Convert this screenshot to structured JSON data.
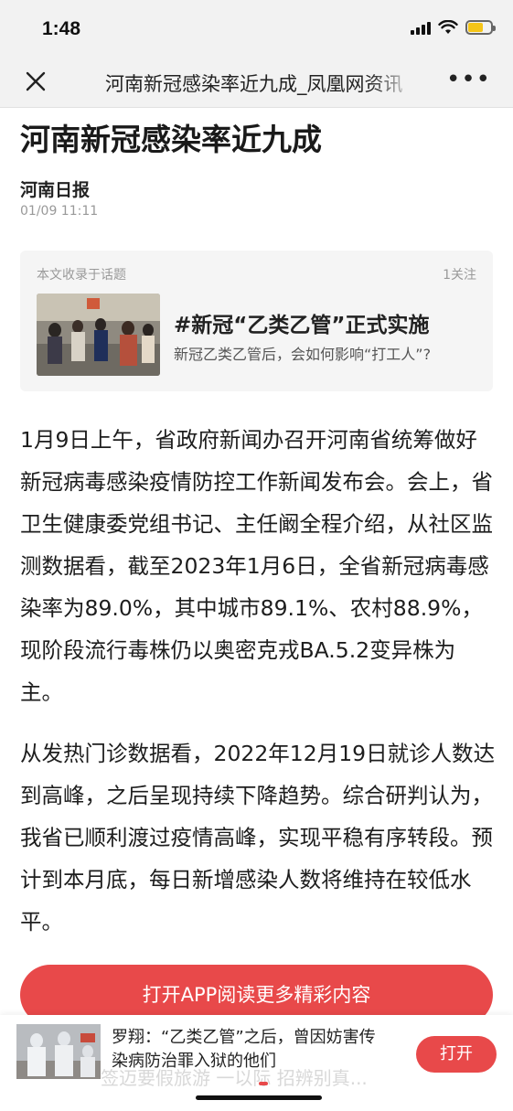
{
  "status_bar": {
    "time": "1:48"
  },
  "nav": {
    "title": "河南新冠感染率近九成_凤凰网资讯",
    "more": "•••"
  },
  "article": {
    "title": "河南新冠感染率近九成",
    "source": "河南日报",
    "date": "01/09 11:11"
  },
  "topic": {
    "label": "本文收录于话题",
    "follow": "1关注",
    "name": "#新冠“乙类乙管”正式实施",
    "desc": "新冠乙类乙管后，会如何影响“打工人”?"
  },
  "paragraphs": [
    "1月9日上午，省政府新闻办召开河南省统筹做好新冠病毒感染疫情防控工作新闻发布会。会上，省卫生健康委党组书记、主任阚全程介绍，从社区监测数据看，截至2023年1月6日，全省新冠病毒感染率为89.0%，其中城市89.1%、农村88.9%，现阶段流行毒株仍以奥密克戎BA.5.2变异株为主。",
    "从发热门诊数据看，2022年12月19日就诊人数达到高峰，之后呈现持续下降趋势。综合研判认为，我省已顺利渡过疫情高峰，实现平稳有序转段。预计到本月底，每日新增感染人数将维持在较低水平。"
  ],
  "open_app_button": "打开APP阅读更多精彩内容",
  "promo": {
    "text": "罗翔：“乙类乙管”之后，曾因妨害传染病防治罪入狱的他们",
    "button": "打开",
    "ghost": "签迈要假旅游   一以际   招辨别真..."
  },
  "colors": {
    "accent": "#e8494a",
    "card_bg": "#f5f5f5",
    "bar_bg": "#f2f2f2"
  }
}
